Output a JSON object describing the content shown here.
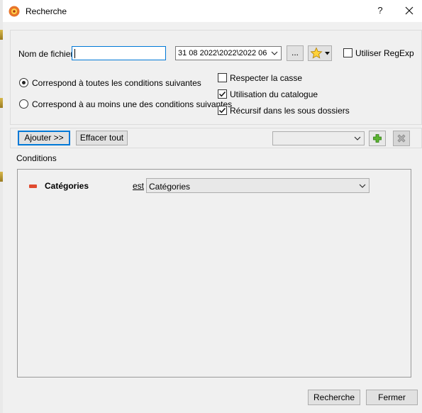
{
  "window": {
    "title": "Recherche",
    "help_label": "?",
    "close_label": "✕",
    "app_icon": "recherche-app-icon"
  },
  "search": {
    "filename_label": "Nom de fichier",
    "filename_value": "",
    "path_value": "31 08 2022\\2022\\2022 06",
    "browse_label": "...",
    "favorites_icon": "star-icon",
    "regexp_label": "Utiliser RegExp",
    "regexp_checked": false
  },
  "match_mode": {
    "all_label": "Correspond à toutes les conditions suivantes",
    "any_label": "Correspond à au moins une des conditions suivantes",
    "selected": "all"
  },
  "options": {
    "case_label": "Respecter la casse",
    "case_checked": false,
    "catalog_label": "Utilisation du catalogue",
    "catalog_checked": true,
    "recursive_label": "Récursif dans les sous dossiers",
    "recursive_checked": true
  },
  "toolbar": {
    "add_label": "Ajouter >>",
    "clear_label": "Effacer tout",
    "preset_value": "",
    "add_preset_icon": "plus-icon",
    "remove_preset_icon": "delete-icon"
  },
  "conditions": {
    "group_label": "Conditions",
    "items": [
      {
        "field": "Catégories",
        "operator": "est",
        "value": "Catégories",
        "remove_icon": "minus-icon"
      }
    ]
  },
  "footer": {
    "search_label": "Recherche",
    "close_label": "Fermer"
  }
}
